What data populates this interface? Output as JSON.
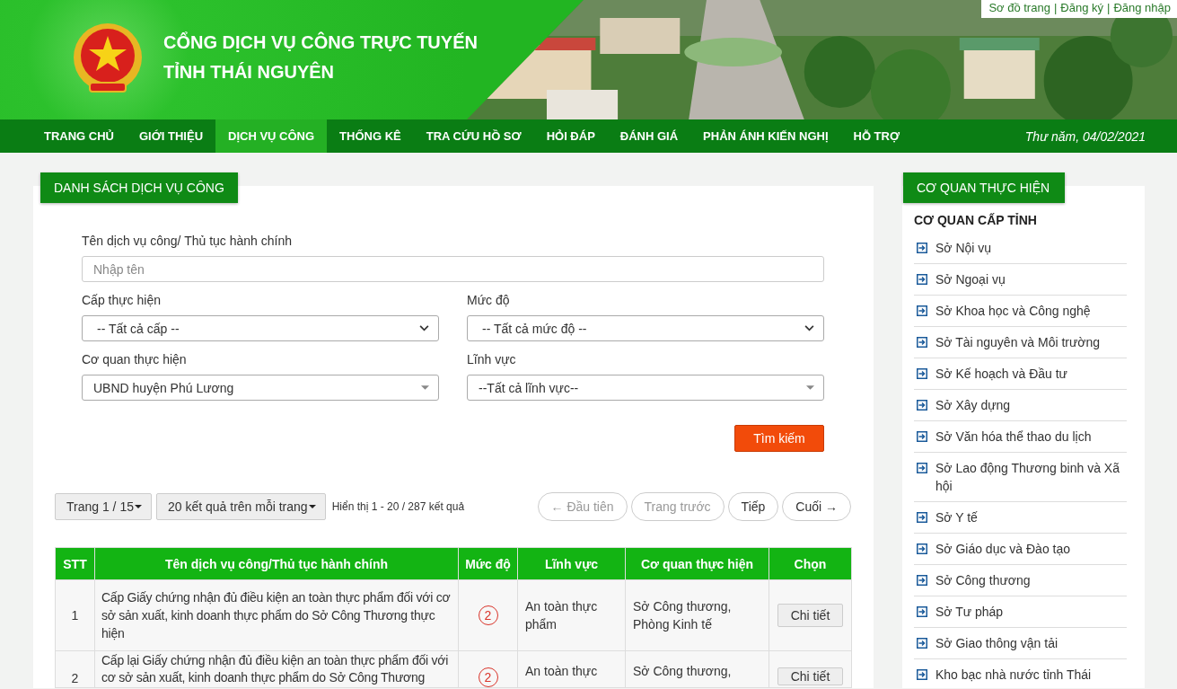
{
  "header": {
    "title_lines": [
      "CỔNG DỊCH VỤ CÔNG TRỰC TUYẾN",
      "TỈNH THÁI NGUYÊN"
    ],
    "photo": {
      "kind": "picture"
    },
    "top_links": [
      "Sơ đồ trang",
      "Đăng ký",
      "Đăng nhập"
    ],
    "top_link_separator": "|"
  },
  "nav": {
    "items": [
      {
        "label": "TRANG CHỦ",
        "selected": false
      },
      {
        "label": "GIỚI THIỆU",
        "selected": false
      },
      {
        "label": "DỊCH VỤ CÔNG",
        "selected": true
      },
      {
        "label": "THỐNG KÊ",
        "selected": false
      },
      {
        "label": "TRA CỨU HỒ SƠ",
        "selected": false
      },
      {
        "label": "HỎI ĐÁP",
        "selected": false
      },
      {
        "label": "ĐÁNH GIÁ",
        "selected": false
      },
      {
        "label": "PHẢN ÁNH KIẾN NGHỊ",
        "selected": false
      },
      {
        "label": "HỖ TRỢ",
        "selected": false
      }
    ],
    "date": "Thư năm, 04/02/2021"
  },
  "main": {
    "heading": "DANH SÁCH DỊCH VỤ CÔNG",
    "search": {
      "label": "Tên dịch vụ công/ Thủ tục hành chính",
      "placeholder": "Nhập tên"
    },
    "filters": [
      {
        "label": "Cấp thực hiện",
        "value": "-- Tất cả cấp --",
        "kind": "native"
      },
      {
        "label": "Mức độ",
        "value": "-- Tất cả mức độ --",
        "kind": "native"
      },
      {
        "label": "Cơ quan thực hiện",
        "value": "UBND huyện Phú Lương",
        "kind": "combo"
      },
      {
        "label": "Lĩnh vực",
        "value": "--Tất cả lĩnh vực--",
        "kind": "combo"
      }
    ],
    "search_button": "Tìm kiếm",
    "pager": {
      "page": "Trang 1 / 15",
      "per_page": "20 kết quả trên mỗi trang",
      "summary": "Hiển thị 1 - 20 / 287 kết quả",
      "buttons": [
        {
          "label": "← Đầu tiên",
          "disabled": true
        },
        {
          "label": "Trang trước",
          "disabled": true
        },
        {
          "label": "Tiếp",
          "disabled": false
        },
        {
          "label": "Cuối →",
          "disabled": false
        }
      ]
    },
    "table": {
      "columns": [
        "STT",
        "Tên dịch vụ công/Thủ tục hành chính",
        "Mức độ",
        "Lĩnh vực",
        "Cơ quan thực hiện",
        "Chọn"
      ],
      "rows": [
        {
          "stt": "1",
          "name": "Cấp Giấy chứng nhận đủ điều kiện an toàn thực phẩm đối với cơ sở sản xuất, kinh doanh thực phẩm do Sở Công Thương thực hiện",
          "level": "2",
          "field": "An toàn thực phẩm",
          "agency": "Sở Công thương, Phòng Kinh tế",
          "action": "Chi tiết"
        },
        {
          "stt": "2",
          "name": "Cấp lại Giấy chứng nhận đủ điều kiện an toàn thực phẩm đối với cơ sở sản xuất, kinh doanh thực phẩm do Sở Công Thương",
          "level": "2",
          "field": "An toàn thực",
          "agency": "Sở Công thương,",
          "action": "Chi tiết"
        }
      ]
    }
  },
  "sidebar": {
    "heading": "CƠ QUAN THỰC HIỆN",
    "group": "CƠ QUAN CẤP TỈNH",
    "items": [
      "Sở Nội vụ",
      "Sở Ngoại vụ",
      "Sở Khoa học và Công nghệ",
      "Sở Tài nguyên và Môi trường",
      "Sở Kế hoạch và Đầu tư",
      "Sở Xây dựng",
      "Sở Văn hóa thể thao du lịch",
      "Sở Lao động Thương binh và Xã hội",
      "Sở Y tế",
      "Sở Giáo dục và Đào tạo",
      "Sở Công thương",
      "Sở Tư pháp",
      "Sở Giao thông vận tải",
      "Kho bạc nhà nước tỉnh Thái"
    ]
  }
}
